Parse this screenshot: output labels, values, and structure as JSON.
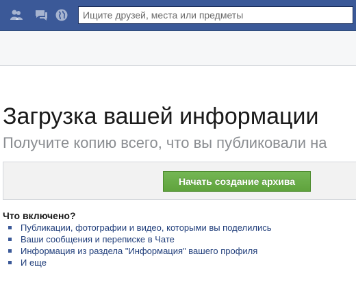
{
  "topbar": {
    "icons": [
      "friends-icon",
      "messages-icon",
      "globe-icon"
    ],
    "search_placeholder": "Ищите друзей, места или предметы",
    "color": "#3b5998"
  },
  "main": {
    "title": "Загрузка вашей информации",
    "subtitle": "Получите копию всего, что вы публиковали на",
    "start_button_label": "Начать создание архива",
    "button_color": "#6aad48",
    "included_title": "Что включено?",
    "included_items": [
      "Публикации, фотографии и видео, которыми вы поделились",
      "Ваши сообщения и переписке в Чате",
      "Информация из раздела \"Информация\" вашего профиля",
      "И еще"
    ]
  }
}
